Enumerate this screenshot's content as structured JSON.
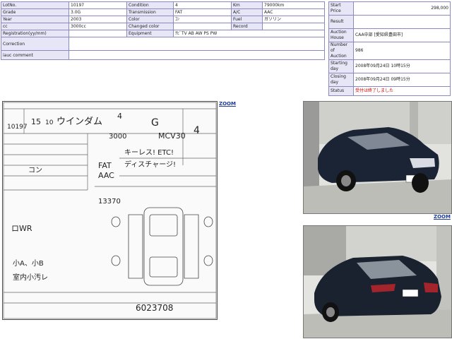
{
  "info": {
    "lot_no_label": "LotNo.",
    "lot_no": "10197",
    "grade_label": "Grade",
    "grade": "3.0G",
    "year_label": "Year",
    "year": "2003",
    "cc_label": "cc",
    "cc": "3000cc",
    "registration_label": "Registration(yy/mm)",
    "registration": "",
    "correction_label": "Correction",
    "correction": "",
    "comment_label": "iauc comment",
    "comment": "",
    "condition_label": "Condition",
    "condition": "4",
    "transmission_label": "Transmission",
    "transmission": "FAT",
    "color_label": "Color",
    "color": "ｺﾝ",
    "changed_color_label": "Changed color",
    "changed_color": "",
    "equipment_label": "Equipment",
    "equipment": "ﾅﾋﾞTV AB AW PS PW",
    "km_label": "Km",
    "km": "79000km",
    "ac_label": "A/C",
    "ac": "AAC",
    "fuel_label": "Fuel",
    "fuel": "ガソリン",
    "record_label": "Record",
    "record": ""
  },
  "auction": {
    "start_price_label": "Start Price",
    "start_price": "298,000",
    "result_label": "Result",
    "result": "",
    "house_label": "Auction House",
    "house": "CAA中部 [愛知県豊田市]",
    "number_label": "Number of Auction",
    "number": "986",
    "starting_label": "Starting day",
    "starting": "2008年09月24日 10時15分",
    "closing_label": "Closing day",
    "closing": "2008年09月24日 09時15分",
    "status_label": "Status",
    "status": "受付は終了しました"
  },
  "links": {
    "zoom": "ZOOM"
  },
  "sheet": {
    "lot": "10197",
    "year_hw": "15",
    "month_hw": "10",
    "model_hw": "ウインダム",
    "grade_hw": "G",
    "score_hw": "4",
    "cc_hw": "3000",
    "code_hw": "MCV30",
    "cond_hw": "4",
    "remark1": "キーレス! ETC!",
    "remark2": "ディスチャージ!",
    "color_hw": "コン",
    "trans_hw": "FAT",
    "ac_hw": "AAC",
    "km_hw": "13370",
    "note1": "ロWR",
    "note2": "小A、小B",
    "note3": "室内小汚レ",
    "serial": "6023708"
  }
}
